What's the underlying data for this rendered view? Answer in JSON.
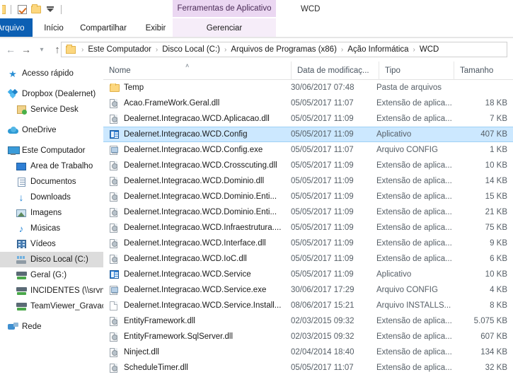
{
  "window": {
    "title": "WCD",
    "contextual_tab_group": "Ferramentas de Aplicativo"
  },
  "quick_access_toolbar": {
    "items": [
      {
        "name": "properties-icon",
        "label": "Propriedades"
      },
      {
        "name": "new-folder-icon",
        "label": "Nova pasta"
      },
      {
        "name": "customize-qat-icon",
        "label": "Personalizar Barra de Ferramentas de Acesso Rápido"
      }
    ]
  },
  "ribbon": {
    "tabs": [
      {
        "label": "Arquivo",
        "active": false,
        "file_tab": true
      },
      {
        "label": "Início",
        "active": false
      },
      {
        "label": "Compartilhar",
        "active": false
      },
      {
        "label": "Exibir",
        "active": false
      },
      {
        "label": "Gerenciar",
        "active": true
      }
    ]
  },
  "address_bar": {
    "back_label": "Voltar",
    "forward_label": "Avançar",
    "recent_label": "Locais recentes",
    "up_label": "Acima",
    "breadcrumbs": [
      "Este Computador",
      "Disco Local (C:)",
      "Arquivos de Programas (x86)",
      "Ação Informática",
      "WCD"
    ],
    "separator": "›"
  },
  "navigation_pane": {
    "items": [
      {
        "label": "Acesso rápido",
        "icon": "star-icon",
        "indent": 0,
        "selected": false,
        "gap_before": false
      },
      {
        "label": "Dropbox (Dealernet)",
        "icon": "dropbox-icon",
        "indent": 0,
        "selected": false,
        "gap_before": true
      },
      {
        "label": "Service Desk",
        "icon": "service-desk-folder-icon",
        "indent": 1,
        "selected": false,
        "gap_before": false
      },
      {
        "label": "OneDrive",
        "icon": "onedrive-cloud-icon",
        "indent": 0,
        "selected": false,
        "gap_before": true
      },
      {
        "label": "Este Computador",
        "icon": "computer-icon",
        "indent": 0,
        "selected": false,
        "gap_before": true
      },
      {
        "label": "Área de Trabalho",
        "icon": "desktop-icon",
        "indent": 1,
        "selected": false,
        "gap_before": false
      },
      {
        "label": "Documentos",
        "icon": "documents-icon",
        "indent": 1,
        "selected": false,
        "gap_before": false
      },
      {
        "label": "Downloads",
        "icon": "downloads-icon",
        "indent": 1,
        "selected": false,
        "gap_before": false
      },
      {
        "label": "Imagens",
        "icon": "pictures-icon",
        "indent": 1,
        "selected": false,
        "gap_before": false
      },
      {
        "label": "Músicas",
        "icon": "music-icon",
        "indent": 1,
        "selected": false,
        "gap_before": false
      },
      {
        "label": "Vídeos",
        "icon": "videos-icon",
        "indent": 1,
        "selected": false,
        "gap_before": false
      },
      {
        "label": "Disco Local (C:)",
        "icon": "local-disk-icon",
        "indent": 1,
        "selected": true,
        "gap_before": false
      },
      {
        "label": "Geral (G:)",
        "icon": "network-drive-icon",
        "indent": 1,
        "selected": false,
        "gap_before": false
      },
      {
        "label": "INCIDENTES (\\\\srvn",
        "icon": "network-drive-icon",
        "indent": 1,
        "selected": false,
        "gap_before": false
      },
      {
        "label": "TeamViewer_Gravac",
        "icon": "network-drive-icon",
        "indent": 1,
        "selected": false,
        "gap_before": false
      },
      {
        "label": "Rede",
        "icon": "network-icon",
        "indent": 0,
        "selected": false,
        "gap_before": true
      }
    ]
  },
  "file_list": {
    "columns": [
      {
        "key": "name",
        "label": "Nome",
        "sorted": true,
        "sort_direction": "asc",
        "sort_glyph": "˄"
      },
      {
        "key": "date",
        "label": "Data de modificaç...",
        "sorted": false
      },
      {
        "key": "type",
        "label": "Tipo",
        "sorted": false
      },
      {
        "key": "size",
        "label": "Tamanho",
        "sorted": false
      }
    ],
    "rows": [
      {
        "name": "Temp",
        "date": "30/06/2017 07:48",
        "type": "Pasta de arquivos",
        "size": "",
        "icon": "folder-icon",
        "selected": false
      },
      {
        "name": "Acao.FrameWork.Geral.dll",
        "date": "05/05/2017 11:07",
        "type": "Extensão de aplica...",
        "size": "18 KB",
        "icon": "dll-icon",
        "selected": false
      },
      {
        "name": "Dealernet.Integracao.WCD.Aplicacao.dll",
        "date": "05/05/2017 11:09",
        "type": "Extensão de aplica...",
        "size": "7 KB",
        "icon": "dll-icon",
        "selected": false
      },
      {
        "name": "Dealernet.Integracao.WCD.Config",
        "date": "05/05/2017 11:09",
        "type": "Aplicativo",
        "size": "407 KB",
        "icon": "application-icon",
        "selected": true
      },
      {
        "name": "Dealernet.Integracao.WCD.Config.exe",
        "date": "05/05/2017 11:07",
        "type": "Arquivo CONFIG",
        "size": "1 KB",
        "icon": "config-icon",
        "selected": false
      },
      {
        "name": "Dealernet.Integracao.WCD.Crosscuting.dll",
        "date": "05/05/2017 11:09",
        "type": "Extensão de aplica...",
        "size": "10 KB",
        "icon": "dll-icon",
        "selected": false
      },
      {
        "name": "Dealernet.Integracao.WCD.Dominio.dll",
        "date": "05/05/2017 11:09",
        "type": "Extensão de aplica...",
        "size": "14 KB",
        "icon": "dll-icon",
        "selected": false
      },
      {
        "name": "Dealernet.Integracao.WCD.Dominio.Enti...",
        "date": "05/05/2017 11:09",
        "type": "Extensão de aplica...",
        "size": "15 KB",
        "icon": "dll-icon",
        "selected": false
      },
      {
        "name": "Dealernet.Integracao.WCD.Dominio.Enti...",
        "date": "05/05/2017 11:09",
        "type": "Extensão de aplica...",
        "size": "21 KB",
        "icon": "dll-icon",
        "selected": false
      },
      {
        "name": "Dealernet.Integracao.WCD.Infraestrutura....",
        "date": "05/05/2017 11:09",
        "type": "Extensão de aplica...",
        "size": "75 KB",
        "icon": "dll-icon",
        "selected": false
      },
      {
        "name": "Dealernet.Integracao.WCD.Interface.dll",
        "date": "05/05/2017 11:09",
        "type": "Extensão de aplica...",
        "size": "9 KB",
        "icon": "dll-icon",
        "selected": false
      },
      {
        "name": "Dealernet.Integracao.WCD.IoC.dll",
        "date": "05/05/2017 11:09",
        "type": "Extensão de aplica...",
        "size": "6 KB",
        "icon": "dll-icon",
        "selected": false
      },
      {
        "name": "Dealernet.Integracao.WCD.Service",
        "date": "05/05/2017 11:09",
        "type": "Aplicativo",
        "size": "10 KB",
        "icon": "application-icon",
        "selected": false
      },
      {
        "name": "Dealernet.Integracao.WCD.Service.exe",
        "date": "30/06/2017 17:29",
        "type": "Arquivo CONFIG",
        "size": "4 KB",
        "icon": "config-icon",
        "selected": false
      },
      {
        "name": "Dealernet.Integracao.WCD.Service.Install...",
        "date": "08/06/2017 15:21",
        "type": "Arquivo INSTALLS...",
        "size": "8 KB",
        "icon": "plain-file-icon",
        "selected": false
      },
      {
        "name": "EntityFramework.dll",
        "date": "02/03/2015 09:32",
        "type": "Extensão de aplica...",
        "size": "5.075 KB",
        "icon": "dll-icon",
        "selected": false
      },
      {
        "name": "EntityFramework.SqlServer.dll",
        "date": "02/03/2015 09:32",
        "type": "Extensão de aplica...",
        "size": "607 KB",
        "icon": "dll-icon",
        "selected": false
      },
      {
        "name": "Ninject.dll",
        "date": "02/04/2014 18:40",
        "type": "Extensão de aplica...",
        "size": "134 KB",
        "icon": "dll-icon",
        "selected": false
      },
      {
        "name": "ScheduleTimer.dll",
        "date": "05/05/2017 11:07",
        "type": "Extensão de aplica...",
        "size": "32 KB",
        "icon": "dll-icon",
        "selected": false
      }
    ]
  },
  "colors": {
    "file_tab": "#0c5fb3",
    "contextual_tab": "#ebd7f2",
    "selection": "#cce8ff",
    "nav_selection": "#dcdcdc"
  }
}
